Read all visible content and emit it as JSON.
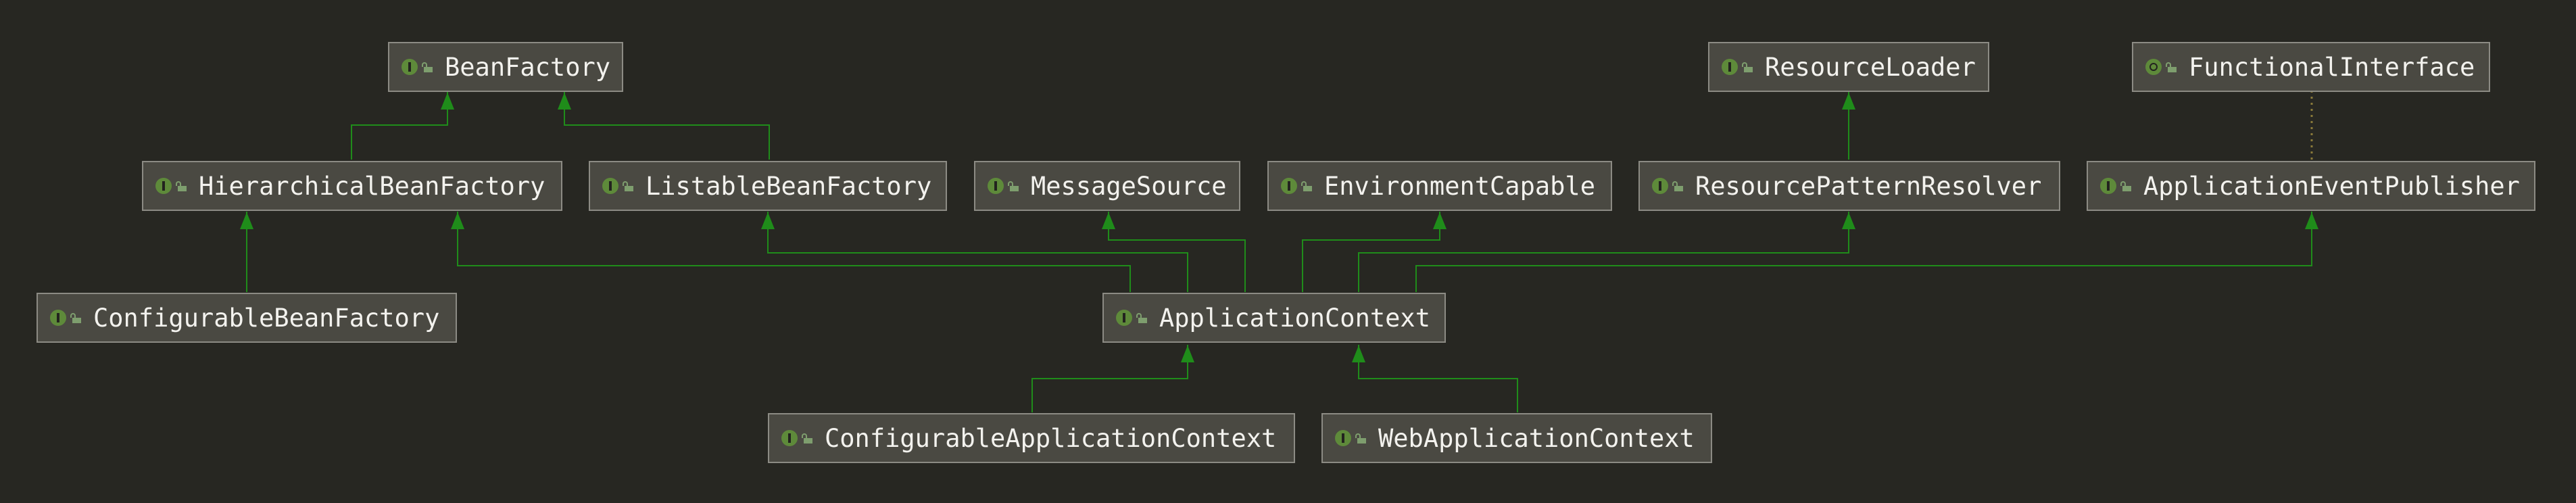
{
  "diagram": {
    "nodes": [
      {
        "id": "BeanFactory",
        "label": "BeanFactory",
        "kind": "interface"
      },
      {
        "id": "ResourceLoader",
        "label": "ResourceLoader",
        "kind": "interface"
      },
      {
        "id": "FunctionalInterface",
        "label": "FunctionalInterface",
        "kind": "annotation"
      },
      {
        "id": "HierarchicalBeanFactory",
        "label": "HierarchicalBeanFactory",
        "kind": "interface"
      },
      {
        "id": "ListableBeanFactory",
        "label": "ListableBeanFactory",
        "kind": "interface"
      },
      {
        "id": "MessageSource",
        "label": "MessageSource",
        "kind": "interface"
      },
      {
        "id": "EnvironmentCapable",
        "label": "EnvironmentCapable",
        "kind": "interface"
      },
      {
        "id": "ResourcePatternResolver",
        "label": "ResourcePatternResolver",
        "kind": "interface"
      },
      {
        "id": "ApplicationEventPublisher",
        "label": "ApplicationEventPublisher",
        "kind": "interface"
      },
      {
        "id": "ConfigurableBeanFactory",
        "label": "ConfigurableBeanFactory",
        "kind": "interface"
      },
      {
        "id": "ApplicationContext",
        "label": "ApplicationContext",
        "kind": "interface"
      },
      {
        "id": "ConfigurableApplicationContext",
        "label": "ConfigurableApplicationContext",
        "kind": "interface"
      },
      {
        "id": "WebApplicationContext",
        "label": "WebApplicationContext",
        "kind": "interface"
      }
    ],
    "edges": [
      {
        "from": "HierarchicalBeanFactory",
        "to": "BeanFactory",
        "type": "extends"
      },
      {
        "from": "ListableBeanFactory",
        "to": "BeanFactory",
        "type": "extends"
      },
      {
        "from": "ResourcePatternResolver",
        "to": "ResourceLoader",
        "type": "extends"
      },
      {
        "from": "ApplicationEventPublisher",
        "to": "FunctionalInterface",
        "type": "annotated"
      },
      {
        "from": "ConfigurableBeanFactory",
        "to": "HierarchicalBeanFactory",
        "type": "extends"
      },
      {
        "from": "ApplicationContext",
        "to": "HierarchicalBeanFactory",
        "type": "extends"
      },
      {
        "from": "ApplicationContext",
        "to": "ListableBeanFactory",
        "type": "extends"
      },
      {
        "from": "ApplicationContext",
        "to": "MessageSource",
        "type": "extends"
      },
      {
        "from": "ApplicationContext",
        "to": "EnvironmentCapable",
        "type": "extends"
      },
      {
        "from": "ApplicationContext",
        "to": "ResourcePatternResolver",
        "type": "extends"
      },
      {
        "from": "ApplicationContext",
        "to": "ApplicationEventPublisher",
        "type": "extends"
      },
      {
        "from": "ConfigurableApplicationContext",
        "to": "ApplicationContext",
        "type": "extends"
      },
      {
        "from": "WebApplicationContext",
        "to": "ApplicationContext",
        "type": "extends"
      }
    ],
    "colors": {
      "background": "#272722",
      "node_fill": "#4a4942",
      "node_border": "#8c8b84",
      "node_text": "#f3f2ee",
      "edge": "#1f8c1a",
      "dotted_edge": "#8a7a3a",
      "interface_icon": "#5e8a3a"
    }
  }
}
